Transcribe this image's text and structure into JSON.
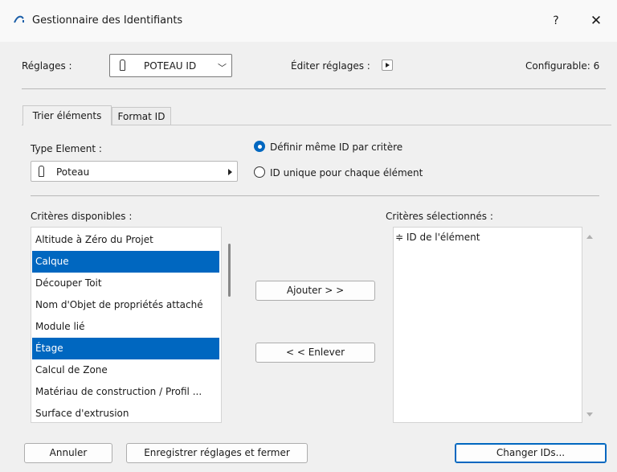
{
  "window": {
    "title": "Gestionnaire des Identifiants",
    "help_label": "?",
    "close_label": "✕"
  },
  "header": {
    "reglages_label": "Réglages :",
    "preset_value": "POTEAU ID",
    "edit_label": "Éditer réglages :",
    "configurable": "Configurable: 6"
  },
  "tabs": [
    {
      "label": "Trier éléments",
      "active": true
    },
    {
      "label": "Format ID",
      "active": false
    }
  ],
  "type_element": {
    "label": "Type Element :",
    "value": "Poteau"
  },
  "radio_options": [
    {
      "label": "Définir même ID par critère",
      "checked": true
    },
    {
      "label": "ID unique pour chaque élément",
      "checked": false
    }
  ],
  "available": {
    "label": "Critères disponibles :",
    "items": [
      {
        "text": "Altitude à Zéro du Projet",
        "selected": false
      },
      {
        "text": "Calque",
        "selected": true
      },
      {
        "text": "Découper Toit",
        "selected": false
      },
      {
        "text": "Nom d'Objet de propriétés attaché",
        "selected": false
      },
      {
        "text": "Module lié",
        "selected": false
      },
      {
        "text": "Étage",
        "selected": true
      },
      {
        "text": "Calcul de Zone",
        "selected": false
      },
      {
        "text": "Matériau de construction / Profil ...",
        "selected": false
      },
      {
        "text": "Surface d'extrusion",
        "selected": false
      }
    ]
  },
  "selected_criteria": {
    "label": "Critères sélectionnés :",
    "items": [
      "≑ ID de l'élément"
    ]
  },
  "buttons": {
    "add": "Ajouter > >",
    "remove": "< < Enlever",
    "cancel": "Annuler",
    "save_close": "Enregistrer réglages et fermer",
    "change_ids": "Changer IDs..."
  },
  "colors": {
    "accent": "#0067c0",
    "window_bg": "#f0f0f0",
    "titlebar_bg": "#f9f9f9"
  }
}
